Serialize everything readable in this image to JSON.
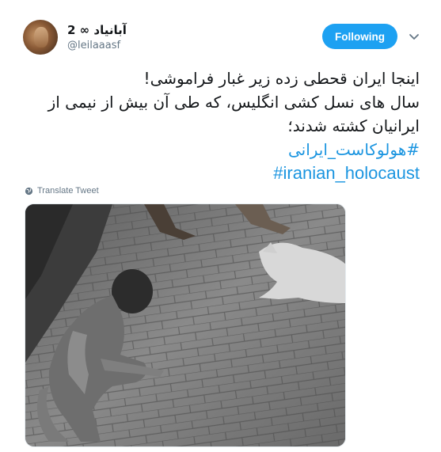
{
  "user": {
    "display_name": "آبانیاد ∞ 2",
    "handle": "@leilaaasf"
  },
  "follow_button": {
    "label": "Following"
  },
  "tweet": {
    "lines": [
      "اینجا ایران قحطی زده زیر غبار فراموشی!",
      "سال های نسل کشی انگلیس، که طی آن بیش از نیمی از",
      "ایرانیان کشته شدند؛"
    ],
    "hashtag_fa": "#هولوکاست_ایرانی",
    "hashtag_en": "#iranian_holocaust"
  },
  "translate": {
    "label": "Translate Tweet"
  },
  "colors": {
    "accent": "#1da1f2",
    "link": "#1b95e0",
    "secondary_text": "#657786"
  },
  "icons": {
    "avatar": "user-avatar",
    "chevron": "chevron-down-icon",
    "globe": "globe-icon"
  }
}
